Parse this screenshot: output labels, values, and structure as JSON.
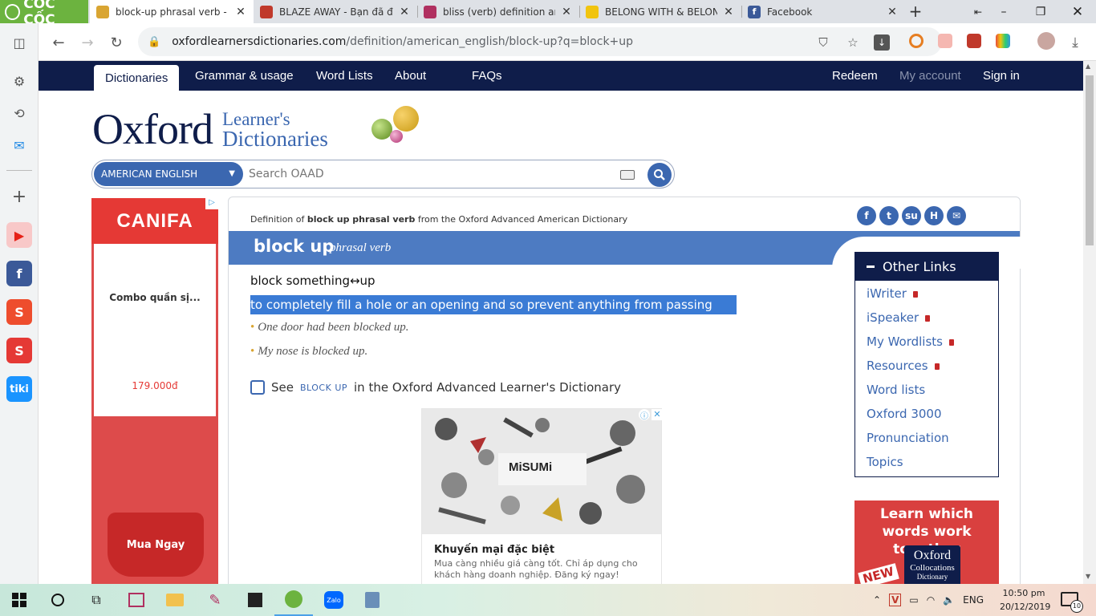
{
  "browser": {
    "brand": "CỐC CỐC",
    "tabs": [
      {
        "label": "block-up phrasal verb - Def",
        "active": true
      },
      {
        "label": "BLAZE AWAY - Bạn đã đánh",
        "active": false
      },
      {
        "label": "bliss (verb) definition and sy",
        "active": false
      },
      {
        "label": "BELONG WITH & BELONG T",
        "active": false
      },
      {
        "label": "Facebook",
        "active": false
      }
    ],
    "url_host": "oxfordlearnersdictionaries.com",
    "url_path": "/definition/american_english/block-up?q=block+up"
  },
  "nav": {
    "items": [
      "Dictionaries",
      "Grammar & usage",
      "Word Lists",
      "About",
      "FAQs"
    ],
    "right": [
      "Redeem",
      "My account",
      "Sign in"
    ]
  },
  "logo": {
    "word": "Oxford",
    "line1": "Learner's",
    "line2": "Dictionaries"
  },
  "search": {
    "language": "AMERICAN ENGLISH",
    "placeholder": "Search OAAD"
  },
  "entry": {
    "crumb_pre": "Definition of ",
    "crumb_word": "block up phrasal verb",
    "crumb_post": " from the Oxford Advanced American Dictionary",
    "headword": "block up",
    "pos": "phrasal verb",
    "sense": "block something↔up",
    "definition": "to completely fill a hole or an opening and so prevent anything from passing through it",
    "examples": [
      "One door had been blocked up.",
      "My nose is blocked up."
    ],
    "see_pre": "See",
    "see_word": "BLOCK UP",
    "see_post": "in the Oxford Advanced Learner's Dictionary"
  },
  "other_links": {
    "title": "Other Links",
    "items": [
      "iWriter",
      "iSpeaker",
      "My Wordlists",
      "Resources",
      "Word lists",
      "Oxford 3000",
      "Pronunciation",
      "Topics"
    ],
    "locked": [
      true,
      true,
      true,
      true,
      false,
      false,
      false,
      false
    ]
  },
  "ad_left": {
    "brand": "CANIFA",
    "product": "Combo quần sị...",
    "price": "179.000đ",
    "button": "Mua Ngay"
  },
  "ad_mid": {
    "brand": "MiSUMi",
    "title": "Khuyến mại đặc biệt",
    "text": "Mua càng nhiều giá càng tốt. Chỉ áp dụng cho khách hàng doanh nghiệp. Đăng ký ngay!"
  },
  "ad_right": {
    "headline": "Learn which words work together",
    "book1": "Oxford",
    "book2": "Collocations",
    "book3": "Dictionary",
    "badge": "NEW"
  },
  "taskbar": {
    "lang": "ENG",
    "time": "10:50 pm",
    "date": "20/12/2019",
    "notif": "10"
  },
  "colors": {
    "navy": "#0f1d4a",
    "blue": "#3b67b0",
    "highlight": "#3a7bd5",
    "coccoc": "#6cb33f"
  }
}
